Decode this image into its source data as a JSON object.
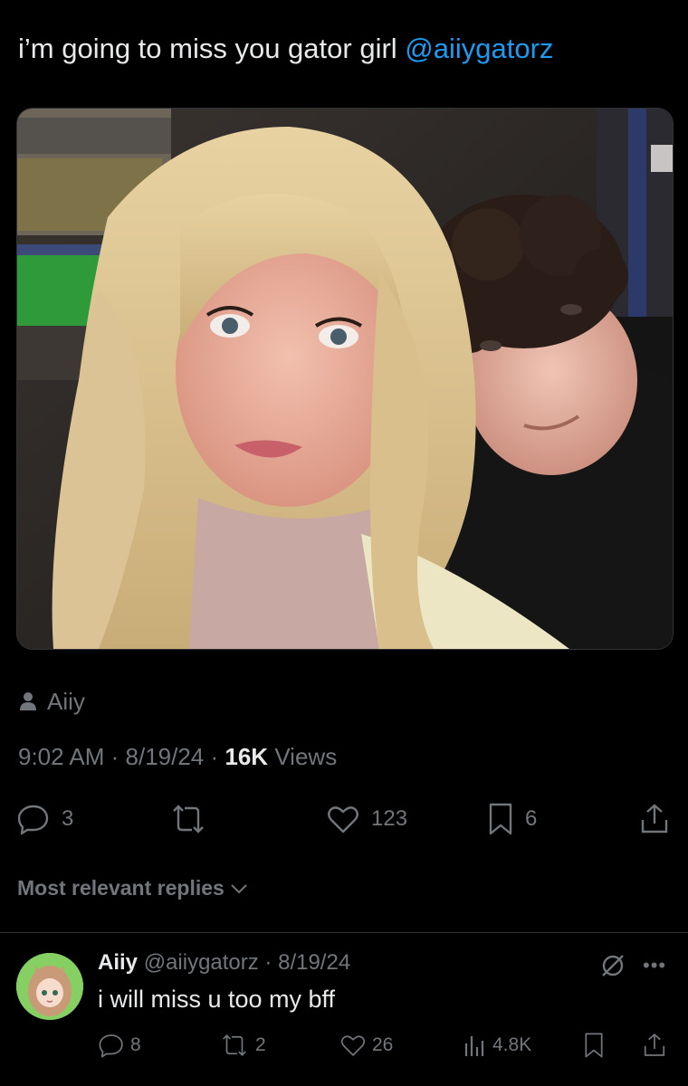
{
  "tweet": {
    "text": "i’m going to miss you gator girl ",
    "mention": "@aiiygatorz",
    "tagged_user": "Aiiy",
    "time": "9:02 AM",
    "date": "8/19/24",
    "views_count": "16K",
    "views_label": "Views",
    "stats": {
      "replies": "3",
      "likes": "123",
      "bookmarks": "6"
    }
  },
  "sort": {
    "label": "Most relevant replies"
  },
  "reply": {
    "name": "Aiiy",
    "handle": "@aiiygatorz",
    "date": "8/19/24",
    "text": "i will miss u too my bff",
    "stats": {
      "replies": "8",
      "reposts": "2",
      "likes": "26",
      "views": "4.8K"
    }
  },
  "icons": [
    "person-icon",
    "reply-icon",
    "repost-icon",
    "like-icon",
    "bookmark-icon",
    "share-icon",
    "chevron-down-icon",
    "mute-icon",
    "more-icon",
    "views-icon"
  ],
  "colors": {
    "background": "#000000",
    "text": "#e7e9ea",
    "secondary": "#71767b",
    "accent": "#1d9bf0",
    "divider": "#2f3336"
  }
}
